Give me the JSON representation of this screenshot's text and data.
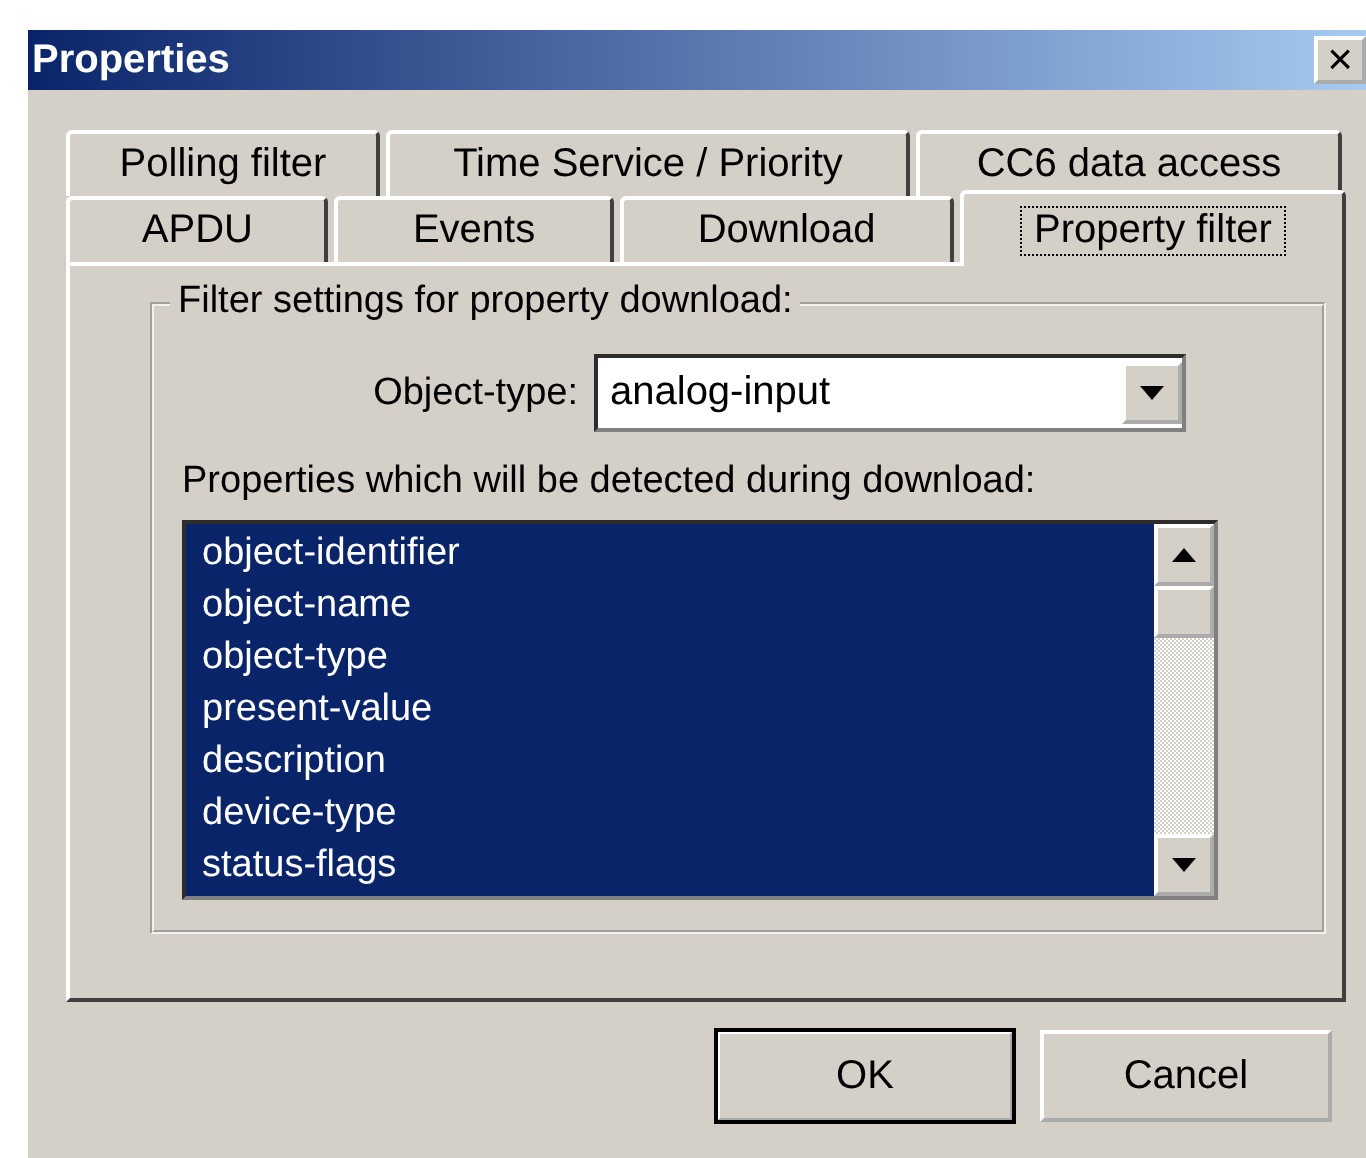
{
  "window": {
    "title": "Properties",
    "close": "×"
  },
  "tab_rows": [
    [
      {
        "label": "Polling filter",
        "selected": false
      },
      {
        "label": "Time Service / Priority",
        "selected": false
      },
      {
        "label": "CC6 data access",
        "selected": false
      }
    ],
    [
      {
        "label": "APDU",
        "selected": false
      },
      {
        "label": "Events",
        "selected": false
      },
      {
        "label": "Download",
        "selected": false
      },
      {
        "label": "Property filter",
        "selected": true
      }
    ]
  ],
  "group": {
    "title": "Filter settings for property download:",
    "object_type_label": "Object-type:",
    "object_type_value": "analog-input",
    "list_label": "Properties which will be detected during download:",
    "properties": [
      {
        "label": "object-identifier",
        "selected": true
      },
      {
        "label": "object-name",
        "selected": true
      },
      {
        "label": "object-type",
        "selected": true
      },
      {
        "label": "present-value",
        "selected": true
      },
      {
        "label": "description",
        "selected": true
      },
      {
        "label": "device-type",
        "selected": true
      },
      {
        "label": "status-flags",
        "selected": true
      }
    ]
  },
  "buttons": [
    {
      "label": "OK",
      "default": true
    },
    {
      "label": "Cancel",
      "default": false
    }
  ]
}
